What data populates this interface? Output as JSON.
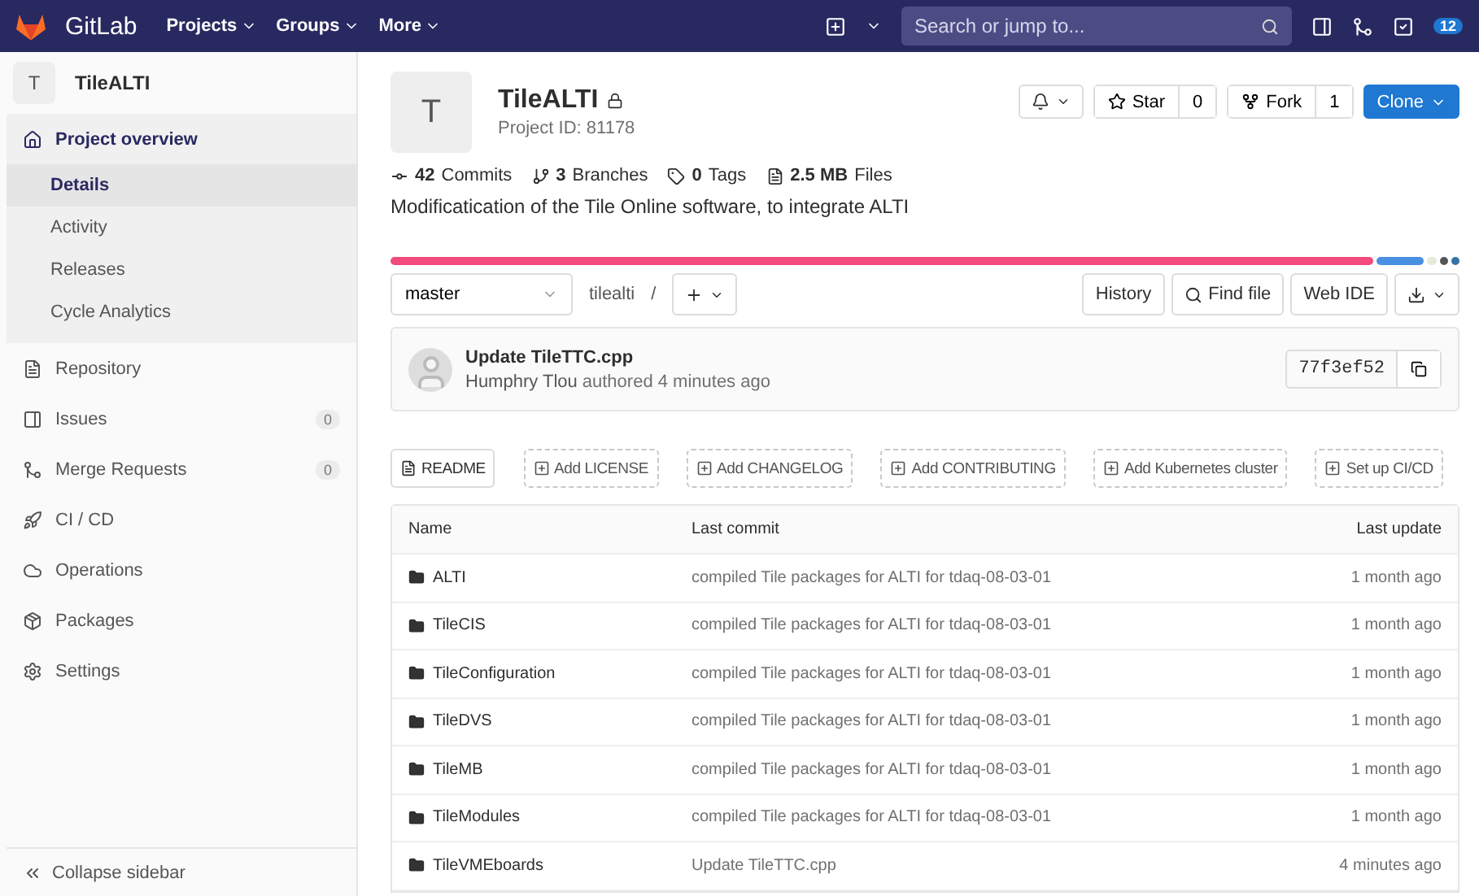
{
  "navbar": {
    "brand": "GitLab",
    "menus": [
      "Projects",
      "Groups",
      "More"
    ],
    "search": {
      "placeholder": "Search or jump to..."
    },
    "todo_count": "12"
  },
  "sidebar": {
    "avatar": "T",
    "project": "TileALTI",
    "items": [
      {
        "label": "Project overview",
        "selected": true,
        "children": [
          {
            "label": "Details",
            "selected": true
          },
          {
            "label": "Activity",
            "selected": false
          },
          {
            "label": "Releases",
            "selected": false
          },
          {
            "label": "Cycle Analytics",
            "selected": false
          }
        ]
      },
      {
        "label": "Repository",
        "selected": false
      },
      {
        "label": "Issues",
        "selected": false,
        "count": "0"
      },
      {
        "label": "Merge Requests",
        "selected": false,
        "count": "0"
      },
      {
        "label": "CI / CD",
        "selected": false
      },
      {
        "label": "Operations",
        "selected": false
      },
      {
        "label": "Packages",
        "selected": false
      },
      {
        "label": "Settings",
        "selected": false
      }
    ],
    "collapse": "Collapse sidebar"
  },
  "project": {
    "avatar": "T",
    "name": "TileALTI",
    "private": true,
    "id_text": "Project ID: 81178",
    "actions": [
      {
        "label": "Star",
        "count": "0"
      },
      {
        "label": "Fork",
        "count": "1"
      }
    ],
    "clone": "Clone",
    "stats": [
      {
        "value": "42",
        "label": "Commits"
      },
      {
        "value": "3",
        "label": "Branches"
      },
      {
        "value": "0",
        "label": "Tags"
      },
      {
        "value": "2.5 MB",
        "label": "Files"
      }
    ],
    "description": "Modificatication of the Tile Online software, to integrate ALTI",
    "languages": [
      {
        "color": "#f34b7d"
      },
      {
        "color": "#4a90e2"
      },
      {
        "color": "#e4ecd9"
      },
      {
        "color": "#555555"
      },
      {
        "color": "#3572a5"
      }
    ]
  },
  "repo_bar": {
    "branch": "master",
    "path": "tilealti",
    "separator": "/",
    "buttons": [
      "History",
      "Find file",
      "Web IDE"
    ]
  },
  "last_commit": {
    "title": "Update TileTTC.cpp",
    "author": "Humphry Tlou",
    "meta": "authored 4 minutes ago",
    "sha": "77f3ef52"
  },
  "shortcuts": [
    {
      "label": "README",
      "kind": "solid"
    },
    {
      "label": "Add LICENSE",
      "kind": "dashed"
    },
    {
      "label": "Add CHANGELOG",
      "kind": "dashed"
    },
    {
      "label": "Add CONTRIBUTING",
      "kind": "dashed"
    },
    {
      "label": "Add Kubernetes cluster",
      "kind": "dashed"
    },
    {
      "label": "Set up CI/CD",
      "kind": "dashed"
    }
  ],
  "table": {
    "columns": [
      "Name",
      "Last commit",
      "Last update"
    ],
    "rows": [
      {
        "name": "ALTI",
        "commit": "compiled Tile packages for ALTI for tdaq-08-03-01",
        "updated": "1 month ago"
      },
      {
        "name": "TileCIS",
        "commit": "compiled Tile packages for ALTI for tdaq-08-03-01",
        "updated": "1 month ago"
      },
      {
        "name": "TileConfiguration",
        "commit": "compiled Tile packages for ALTI for tdaq-08-03-01",
        "updated": "1 month ago"
      },
      {
        "name": "TileDVS",
        "commit": "compiled Tile packages for ALTI for tdaq-08-03-01",
        "updated": "1 month ago"
      },
      {
        "name": "TileMB",
        "commit": "compiled Tile packages for ALTI for tdaq-08-03-01",
        "updated": "1 month ago"
      },
      {
        "name": "TileModules",
        "commit": "compiled Tile packages for ALTI for tdaq-08-03-01",
        "updated": "1 month ago"
      },
      {
        "name": "TileVMEboards",
        "commit": "Update TileTTC.cpp",
        "updated": "4 minutes ago"
      }
    ]
  }
}
